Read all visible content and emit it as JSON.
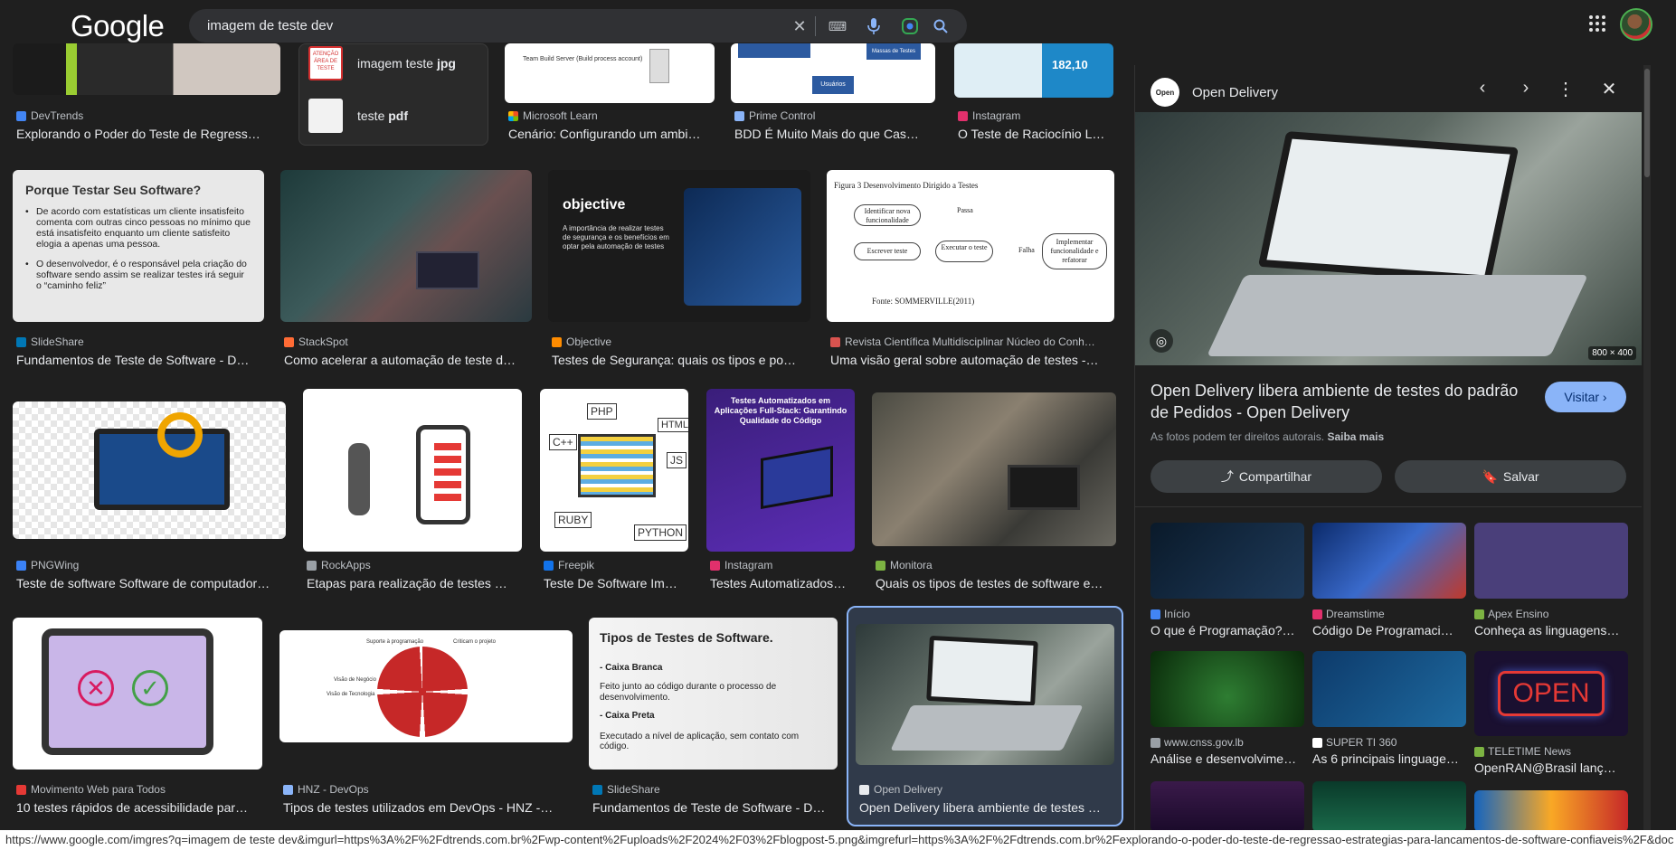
{
  "header": {
    "logo": "Google",
    "query": "imagem de teste dev"
  },
  "doc_results": [
    {
      "badge": "ATENÇÃO ÁREA DE TESTE",
      "label_prefix": "imagem teste ",
      "label_ext": "jpg"
    },
    {
      "label_prefix": "teste ",
      "label_ext": "pdf"
    }
  ],
  "grid": [
    {
      "source": "DevTrends",
      "title": "Explorando o Poder do Teste de Regress…",
      "fav": "#4285f4"
    },
    {
      "source": "Microsoft Learn",
      "title": "Cenário: Configurando um ambi…",
      "fav": "#f25022"
    },
    {
      "source": "Prime Control",
      "title": "BDD É Muito Mais do que Cas…",
      "fav": "#8ab4f8"
    },
    {
      "source": "Instagram",
      "title": "O Teste de Raciocínio L…",
      "fav": "#e1306c"
    },
    {
      "source": "SlideShare",
      "title": "Fundamentos de Teste de Software - D…",
      "fav": "#0077b5"
    },
    {
      "source": "StackSpot",
      "title": "Como acelerar a automação de teste d…",
      "fav": "#ff6b35"
    },
    {
      "source": "Objective",
      "title": "Testes de Segurança: quais os tipos e po…",
      "fav": "#ff8c00"
    },
    {
      "source": "Revista Científica Multidisciplinar Núcleo do Conh…",
      "title": "Uma visão geral sobre automação de testes -…",
      "fav": "#d9534f"
    },
    {
      "source": "PNGWing",
      "title": "Teste de software Software de computador…",
      "fav": "#3b82f6"
    },
    {
      "source": "RockApps",
      "title": "Etapas para realização de testes …",
      "fav": "#9aa0a6"
    },
    {
      "source": "Freepik",
      "title": "Teste De Software Im…",
      "fav": "#1273eb"
    },
    {
      "source": "Instagram",
      "title": "Testes Automatizados…",
      "fav": "#e1306c"
    },
    {
      "source": "Monitora",
      "title": "Quais os tipos de testes de software e…",
      "fav": "#7cb342"
    },
    {
      "source": "Movimento Web para Todos",
      "title": "10 testes rápidos de acessibilidade par…",
      "fav": "#e53935"
    },
    {
      "source": "HNZ - DevOps",
      "title": "Tipos de testes utilizados em DevOps - HNZ -…",
      "fav": "#8ab4f8"
    },
    {
      "source": "SlideShare",
      "title": "Fundamentos de Teste de Software - D…",
      "fav": "#0077b5"
    },
    {
      "source": "Open Delivery",
      "title": "Open Delivery libera ambiente de testes …",
      "fav": "#e8eaed"
    }
  ],
  "thumbs": {
    "slide1_title": "Porque Testar Seu Software?",
    "slide1_bullets": [
      "De acordo com estatísticas um cliente insatisfeito comenta com outras cinco pessoas no mínimo que está insatisfeito enquanto um cliente satisfeito elogia a apenas uma pessoa.",
      "O desenvolvedor, é o responsável pela criação do software sendo assim se realizar testes irá seguir o “caminho feliz”"
    ],
    "objective_brand": "objective",
    "objective_text": "A importância de realizar testes de segurança e os benefícios em optar pela automação de testes",
    "fig_caption": "Figura 3    Desenvolvimento Dirigido a Testes",
    "fig_source": "Fonte: SOMMERVILLE(2011)",
    "fig_nodes": [
      "Identificar nova funcionalidade",
      "Escrever teste",
      "Executar o teste",
      "Implementar funcionalidade e refatorar",
      "Passa",
      "Falha"
    ],
    "insta_text": "Testes Automatizados em Aplicações Full-Stack: Garantindo Qualidade do Código",
    "tipos_title": "Tipos de Testes de Software.",
    "tipos_lines": [
      "- Caixa Branca",
      "Feito junto ao código durante o processo de desenvolvimento.",
      "- Caixa Preta",
      "Executado a nível de aplicação, sem contato com código."
    ],
    "devops_labels": [
      "Suporte à programação",
      "Criticam o projeto",
      "Visão de Negócio",
      "Visão de Tecnologia"
    ],
    "ms_text": "Team Build Server (Build process account)",
    "bdd_label": "Usuários",
    "bdd_label2": "Massas de Testes",
    "insta_price": "182,10",
    "code_tags": [
      "PHP",
      "HTML",
      "C++",
      "JS",
      "RUBY",
      "PYTHON"
    ]
  },
  "panel": {
    "site": "Open Delivery",
    "logo_text": "Open",
    "dims": "800 × 400",
    "title": "Open Delivery libera ambiente de testes do padrão de Pedidos - Open Delivery",
    "visit": "Visitar",
    "copyright": "As fotos podem ter direitos autorais.",
    "learn_more": "Saiba mais",
    "share": "Compartilhar",
    "save": "Salvar",
    "related": [
      {
        "source": "Início",
        "title": "O que é Programação?…",
        "fav": "#4285f4"
      },
      {
        "source": "Dreamstime",
        "title": "Código De Programaci…",
        "fav": "#e1306c"
      },
      {
        "source": "Apex Ensino",
        "title": "Conheça as linguagens…",
        "fav": "#7cb342"
      },
      {
        "source": "www.cnss.gov.lb",
        "title": "Análise e desenvolvime…",
        "fav": "#9aa0a6"
      },
      {
        "source": "SUPER TI 360",
        "title": "As 6 principais linguage…",
        "fav": "#ffffff"
      },
      {
        "source": "TELETIME News",
        "title": "OpenRAN@Brasil lanç…",
        "fav": "#7cb342"
      }
    ],
    "open_sign": "OPEN"
  },
  "status_url": "https://www.google.com/imgres?q=imagem de teste dev&imgurl=https%3A%2F%2Fdtrends.com.br%2Fwp-content%2Fuploads%2F2024%2F03%2Fblogpost-5.png&imgrefurl=https%3A%2F%2Fdtrends.com.br%2Fexplorando-o-poder-do-teste-de-regressao-estrategias-para-lancamentos-de-software-confiaveis%2F&doc"
}
